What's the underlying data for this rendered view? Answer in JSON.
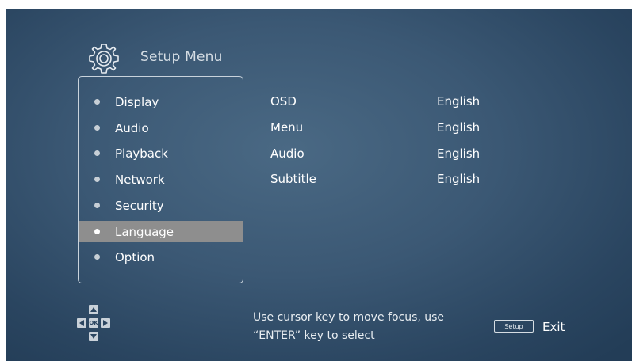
{
  "header": {
    "title": "Setup Menu",
    "icon": "gear-icon"
  },
  "menu": {
    "items": [
      {
        "label": "Display",
        "selected": false
      },
      {
        "label": "Audio",
        "selected": false
      },
      {
        "label": "Playback",
        "selected": false
      },
      {
        "label": "Network",
        "selected": false
      },
      {
        "label": "Security",
        "selected": false
      },
      {
        "label": "Language",
        "selected": true
      },
      {
        "label": "Option",
        "selected": false
      }
    ]
  },
  "options": [
    {
      "label": "OSD",
      "value": "English"
    },
    {
      "label": "Menu",
      "value": "English"
    },
    {
      "label": "Audio",
      "value": "English"
    },
    {
      "label": "Subtitle",
      "value": "English"
    }
  ],
  "footer": {
    "dpad_ok": "OK",
    "hint_line1": "Use cursor key to move focus, use",
    "hint_line2": "“ENTER” key to select",
    "setup_key": "Setup",
    "exit_label": "Exit"
  },
  "colors": {
    "background": "#3b5874",
    "selected_row": "#8e8e8e",
    "text": "#ffffff"
  }
}
